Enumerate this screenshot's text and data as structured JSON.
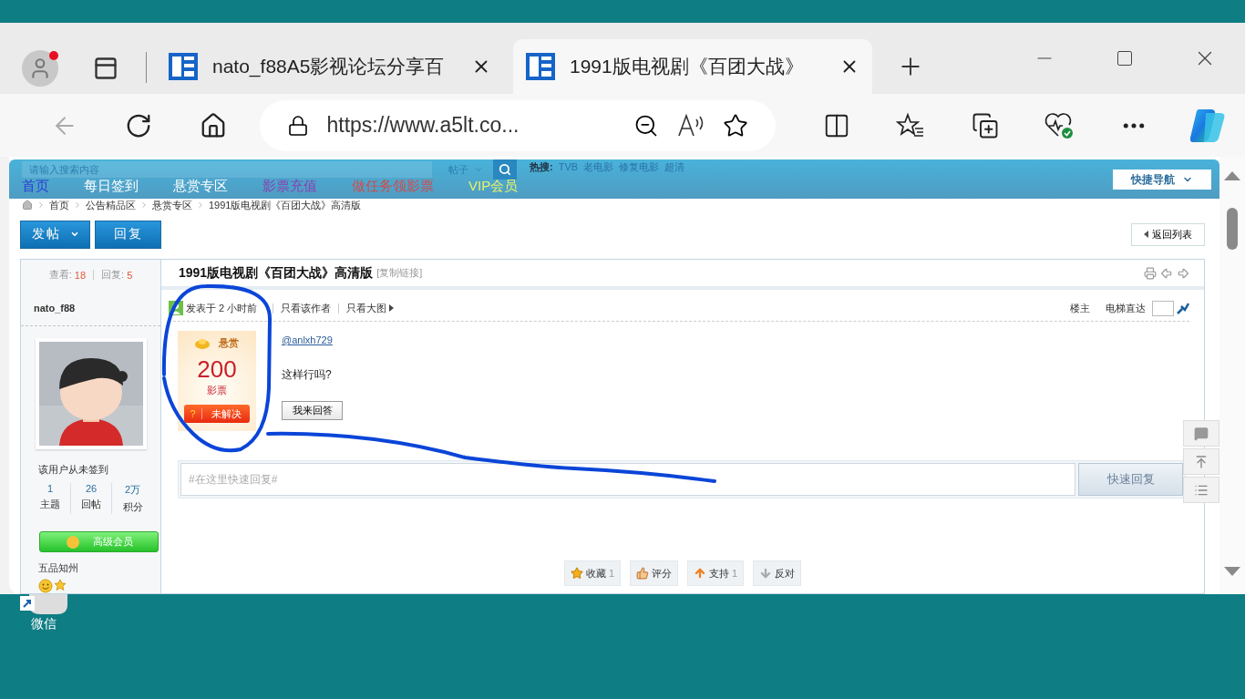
{
  "browser": {
    "tabs": [
      {
        "title": "nato_f88A5影视论坛分享百",
        "selected": false
      },
      {
        "title": "1991版电视剧《百团大战》",
        "selected": true
      }
    ],
    "address": {
      "url": "https://www.a5lt.co..."
    }
  },
  "site": {
    "search": {
      "placeholder": "请输入搜索内容",
      "scope": "帖子",
      "hot_label": "热搜:",
      "hot_terms": [
        "TVB",
        "老电影",
        "修复电影",
        "超清"
      ]
    },
    "nav": [
      {
        "label": "首页",
        "color": "#2b3fd0"
      },
      {
        "label": "每日签到",
        "color": "#ffffff"
      },
      {
        "label": "悬赏专区",
        "color": "#ffffff"
      },
      {
        "label": "影票充值",
        "color": "#8a3fb0"
      },
      {
        "label": "做任务领影票",
        "color": "#d34a4a"
      },
      {
        "label": "VIP会员",
        "color": "#e8f26a"
      }
    ],
    "quick_nav": "快捷导航"
  },
  "breadcrumb": [
    "首页",
    "公告精品区",
    "悬赏专区",
    "1991版电视剧《百团大战》高清版"
  ],
  "actions": {
    "post": "发帖",
    "reply": "回复",
    "back": "返回列表"
  },
  "thread": {
    "views_label": "查看:",
    "views": "18",
    "replies_label": "回复:",
    "replies": "5",
    "title": "1991版电视剧《百团大战》高清版",
    "copy_link": "[复制链接]"
  },
  "author": {
    "name": "nato_f88",
    "checkin": "该用户从未签到",
    "stats": [
      {
        "value": "1",
        "label": "主题"
      },
      {
        "value": "26",
        "label": "回帖"
      },
      {
        "value": "2万",
        "label": "积分"
      }
    ],
    "group": "高级会员",
    "rank": "五品知州"
  },
  "post": {
    "posted": "发表于 2 小时前",
    "only_author": "只看该作者",
    "big_images": "只看大图",
    "floor": "楼主",
    "jump_label": "电梯直达",
    "mention": "@anlxh729",
    "body": "这样行吗?",
    "answer_button": "我来回答"
  },
  "bounty": {
    "label": "悬赏",
    "amount": "200",
    "unit": "影票",
    "status_icon": "?",
    "status": "未解决"
  },
  "quick_reply": {
    "placeholder": "#在这里快速回复#",
    "button": "快速回复"
  },
  "reactions": [
    {
      "label": "收藏",
      "count": "1"
    },
    {
      "label": "评分"
    },
    {
      "label": "支持",
      "count": "1"
    },
    {
      "label": "反对"
    }
  ],
  "desktop": {
    "icons": [
      {
        "label": "微信"
      }
    ]
  }
}
